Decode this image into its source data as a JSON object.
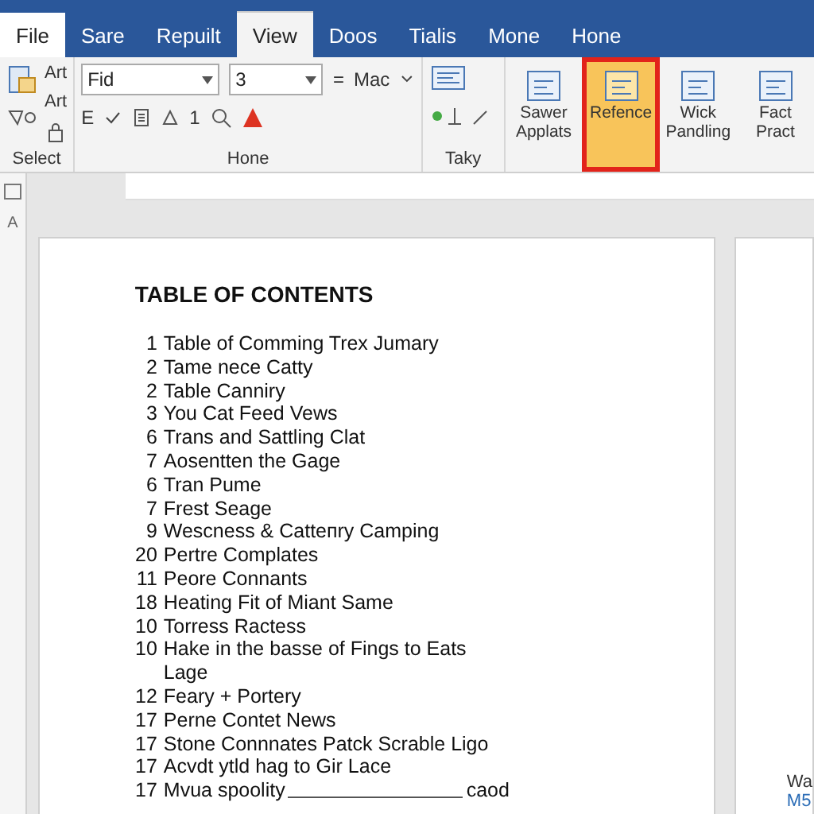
{
  "tabs": [
    {
      "label": "File",
      "kind": "file",
      "selected": false
    },
    {
      "label": "Sare",
      "kind": "tab",
      "selected": false
    },
    {
      "label": "Repuilt",
      "kind": "tab",
      "selected": false
    },
    {
      "label": "View",
      "kind": "tab",
      "selected": true
    },
    {
      "label": "Doos",
      "kind": "tab",
      "selected": false
    },
    {
      "label": "Tialis",
      "kind": "tab",
      "selected": false
    },
    {
      "label": "Mone",
      "kind": "tab",
      "selected": false
    },
    {
      "label": "Hone",
      "kind": "tab",
      "selected": false
    }
  ],
  "ribbon": {
    "select_group": {
      "items": [
        "Art",
        "Art"
      ],
      "label": "Select"
    },
    "font_group": {
      "font": "Fid",
      "size": "3",
      "equals": "=",
      "style": "Mac",
      "row2_letter": "E",
      "row2_number": "1",
      "label": "Hone"
    },
    "taky_group": {
      "label": "Taky"
    },
    "big_buttons": [
      {
        "label": "Sawer Applats",
        "selected": false
      },
      {
        "label": "Refence",
        "selected": true
      },
      {
        "label": "Wick Pandling",
        "selected": false
      },
      {
        "label": "Fact Pract",
        "selected": false
      }
    ]
  },
  "side_letter": "A",
  "document": {
    "title": "TABLE OF CONTENTS",
    "entries": [
      {
        "number": "1",
        "text": "Table of Comming Trex Jumary"
      },
      {
        "number": "2",
        "text": "Tame nece Catty"
      },
      {
        "number": "2",
        "text": "Table Canniry"
      },
      {
        "number": "3",
        "text": "You Cat Feed Vews"
      },
      {
        "number": "6",
        "text": "Trans and Sattling Clat"
      },
      {
        "number": "7",
        "text": "Aosentten the Gage"
      },
      {
        "number": "6",
        "text": "Tran Pume"
      },
      {
        "number": "7",
        "text": "Frest Seage"
      },
      {
        "number": "9",
        "text": "Wescness & Catteпry Camping"
      },
      {
        "number": "20",
        "text": "Pertre Complates"
      },
      {
        "number": "11",
        "text": "Peore Connants"
      },
      {
        "number": "18",
        "text": "Heating Fit of Miant Same"
      },
      {
        "number": "10",
        "text": "Torress Ractess"
      },
      {
        "number": "10",
        "text": "Hake in the basse of Fings to Eats Lage"
      },
      {
        "number": "12",
        "text": "Feary + Portery"
      },
      {
        "number": "17",
        "text": "Perne Contet News"
      },
      {
        "number": "17",
        "text": "Stone Connnates Patck Scrable Ligo"
      },
      {
        "number": "17",
        "text": "Acvdt ytld hag to Gir Lace"
      },
      {
        "number": "17",
        "text": "Mvua spoolity",
        "tail": "caod"
      }
    ]
  },
  "second_page": {
    "lines": [
      "Wa",
      "M5"
    ]
  }
}
